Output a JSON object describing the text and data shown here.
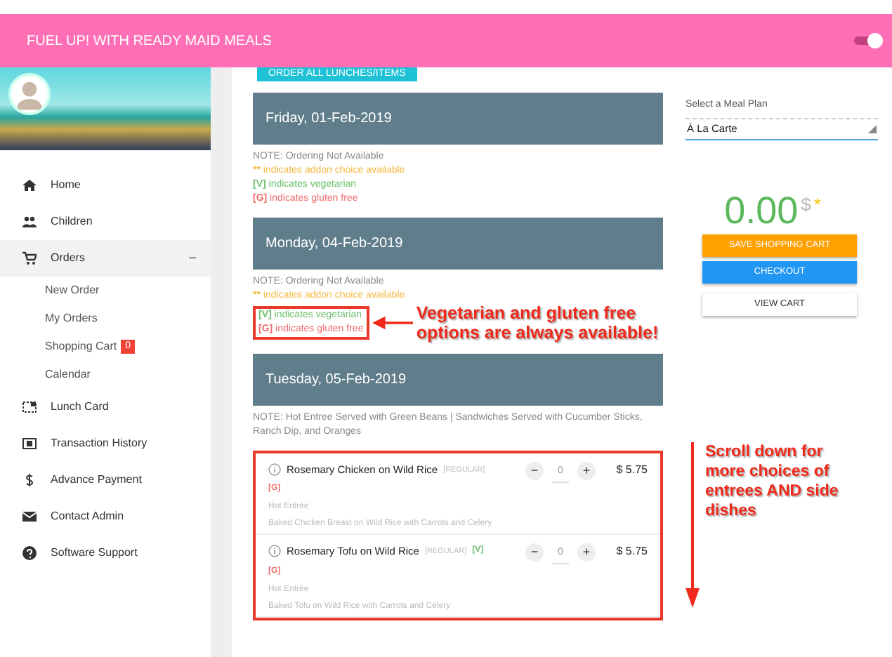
{
  "header": {
    "title": "FUEL UP! WITH READY MAID MEALS",
    "toggle_on": true
  },
  "sidebar": {
    "items": [
      {
        "label": "Home",
        "selected": false
      },
      {
        "label": "Children",
        "selected": false
      },
      {
        "label": "Orders",
        "selected": true,
        "expanded": true,
        "toggle": "−",
        "children": [
          {
            "label": "New Order",
            "selected": false
          },
          {
            "label": "My Orders",
            "selected": false
          },
          {
            "label": "Shopping Cart",
            "selected": false,
            "badge": "0"
          },
          {
            "label": "Calendar",
            "selected": false
          }
        ]
      },
      {
        "label": "Lunch Card",
        "selected": false
      },
      {
        "label": "Transaction History",
        "selected": false
      },
      {
        "label": "Advance Payment",
        "selected": false
      },
      {
        "label": "Contact Admin",
        "selected": false
      },
      {
        "label": "Software Support",
        "selected": false
      }
    ]
  },
  "order_all_button": "ORDER ALL LUNCHES/ITEMS",
  "days": [
    {
      "date": "Friday, 01-Feb-2019",
      "note": "NOTE: Ordering Not Available",
      "legend": [
        {
          "mark": "**",
          "text": "indicates addon choice available",
          "kind": "addon",
          "boxed": false
        },
        {
          "mark": "[V]",
          "text": "indicates vegetarian",
          "kind": "veg",
          "boxed": false
        },
        {
          "mark": "[G]",
          "text": "indicates gluten free",
          "kind": "gf",
          "boxed": false
        }
      ]
    },
    {
      "date": "Monday, 04-Feb-2019",
      "note": "NOTE: Ordering Not Available",
      "callout": "Vegetarian and gluten free options are always available!",
      "legend": [
        {
          "mark": "**",
          "text": "indicates addon choice available",
          "kind": "addon",
          "boxed": false
        },
        {
          "mark": "[V]",
          "text": "indicates vegetarian",
          "kind": "veg",
          "boxed": true
        },
        {
          "mark": "[G]",
          "text": "indicates gluten free",
          "kind": "gf",
          "boxed": true
        }
      ]
    },
    {
      "date": "Tuesday, 05-Feb-2019",
      "note": "NOTE: Hot Entree Served with Green Beans | Sandwiches Served with Cucumber Sticks, Ranch Dip, and Oranges",
      "items_highlighted": true,
      "items": [
        {
          "name": "Rosemary Chicken on Wild Rice",
          "size": "[REGULAR]",
          "tags": [
            {
              "text": "[G]",
              "kind": "gf",
              "inline": false
            }
          ],
          "category": "Hot Entrée",
          "description": "Baked Chicken Breast on Wild Rice with Carrots and Celery",
          "minus": "−",
          "qty": "0",
          "plus": "+",
          "price": "$ 5.75"
        },
        {
          "name": "Rosemary Tofu on Wild Rice",
          "size": "[REGULAR]",
          "tags": [
            {
              "text": "[V]",
              "kind": "veg",
              "inline": true
            },
            {
              "text": "[G]",
              "kind": "gf",
              "inline": false
            }
          ],
          "category": "Hot Entrée",
          "description": "Baked Tofu on Wild Rice with Carrots and Celery",
          "minus": "−",
          "qty": "0",
          "plus": "+",
          "price": "$ 5.75"
        }
      ]
    }
  ],
  "meal_plan": {
    "label": "Select a Meal Plan",
    "value": "À La Carte"
  },
  "total": {
    "amount": "0.00",
    "currency": "$",
    "mark": "*"
  },
  "buttons": [
    {
      "label": "SAVE SHOPPING CART",
      "kind": "warning"
    },
    {
      "label": "CHECKOUT",
      "kind": "primary"
    },
    {
      "label": "VIEW CART",
      "kind": "light"
    }
  ],
  "scroll_note": "Scroll down for more choices of entrees AND side dishes"
}
